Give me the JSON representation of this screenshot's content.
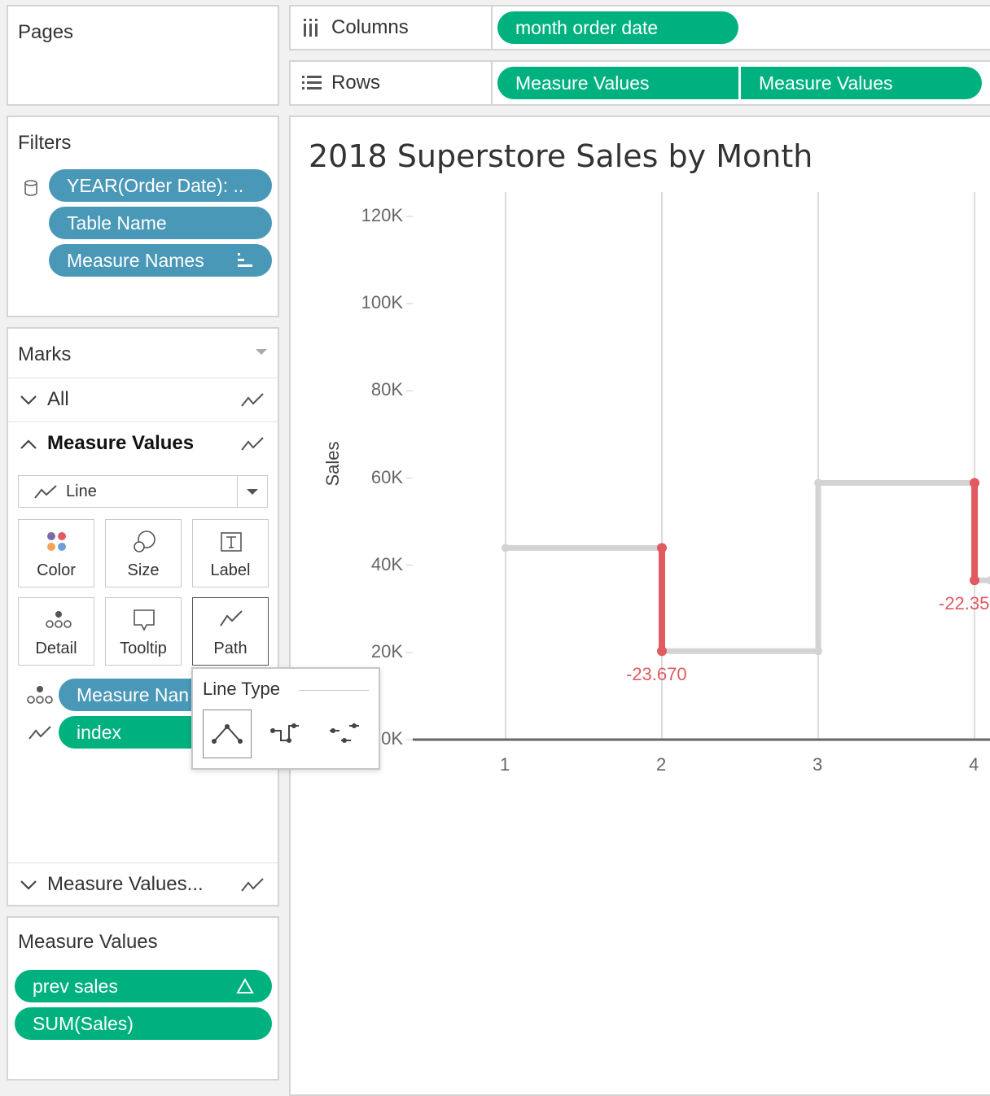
{
  "pages": {
    "title": "Pages"
  },
  "filters": {
    "title": "Filters",
    "items": [
      "YEAR(Order Date): ..",
      "Table Name",
      "Measure Names"
    ]
  },
  "marks": {
    "title": "Marks",
    "cards": {
      "all": "All",
      "measure_values": "Measure Values",
      "measure_values_2": "Measure Values..."
    },
    "mark_type": "Line",
    "buttons": {
      "color": "Color",
      "size": "Size",
      "label": "Label",
      "detail": "Detail",
      "tooltip": "Tooltip",
      "path": "Path"
    },
    "fields": [
      "Measure Nan",
      "index"
    ]
  },
  "line_type_popup": {
    "title": "Line Type"
  },
  "measure_values_card": {
    "title": "Measure Values",
    "items": [
      "prev sales",
      "SUM(Sales)"
    ]
  },
  "shelves": {
    "columns_label": "Columns",
    "columns_pills": [
      "month order date"
    ],
    "rows_label": "Rows",
    "rows_pills": [
      "Measure Values",
      "Measure Values"
    ]
  },
  "colors": {
    "blue_pill": "#4a98b8",
    "green_pill": "#00b180",
    "highlight": "#e05a5f",
    "line": "#d3d3d3"
  },
  "chart_data": {
    "type": "line",
    "title": "2018 Superstore Sales by Month",
    "ylabel": "Sales",
    "xlabel": "",
    "x_ticks": [
      "1",
      "2",
      "3",
      "4"
    ],
    "y_ticks": [
      "120K",
      "100K",
      "80K",
      "60K",
      "40K",
      "20K",
      "0K"
    ],
    "ylim": [
      0,
      120000
    ],
    "xlim": [
      0.4,
      4.1
    ],
    "line_type": "step",
    "series": [
      {
        "points": [
          [
            1,
            43971
          ],
          [
            2,
            43971
          ],
          [
            2,
            20301
          ],
          [
            3,
            20301
          ],
          [
            3,
            58872
          ],
          [
            4,
            58872
          ],
          [
            4,
            36522
          ],
          [
            4.1,
            36522
          ]
        ]
      }
    ],
    "drops": [
      {
        "x": 2,
        "from": 43971,
        "to": 20301,
        "label": "-23.670"
      },
      {
        "x": 4,
        "from": 58872,
        "to": 36522,
        "label": "-22.35"
      }
    ]
  }
}
